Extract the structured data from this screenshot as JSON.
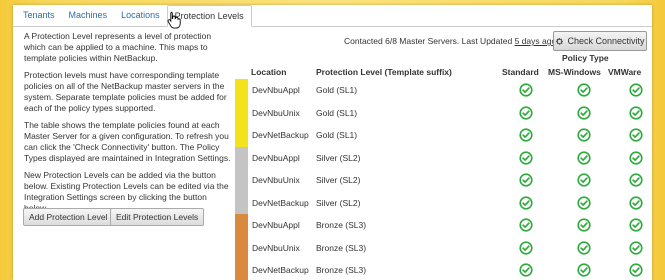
{
  "tabs": [
    {
      "label": "Tenants"
    },
    {
      "label": "Machines"
    },
    {
      "label": "Locations"
    },
    {
      "label": "Protection Levels",
      "active": true
    }
  ],
  "description": [
    "A Protection Level represents a level of protection which can be applied to a machine. This maps to template policies within NetBackup.",
    "Protection levels must have corresponding template policies on all of the NetBackup master servers in the system. Separate template policies must be added for each of the policy types supported.",
    "The table shows the template policies found at each Master Server for a given configuration. To refresh you can click the 'Check Connectivity' button. The Policy Types displayed are maintained in Integration Settings.",
    "New Protection Levels can be added via the button below. Existing Protection Levels can be edited via the Integration Settings screen by clicking the button below."
  ],
  "buttons": {
    "add": "Add Protection Level",
    "edit": "Edit Protection Levels",
    "check": "Check Connectivity"
  },
  "status": {
    "prefix": "Contacted 6/8 Master Servers. Last Updated",
    "link": "5 days ago"
  },
  "table": {
    "policy_type_header": "Policy Type",
    "col_location": "Location",
    "col_level": "Protection Level (Template suffix)",
    "col_standard": "Standard",
    "col_mswindows": "MS-Windows",
    "col_vmware": "VMWare",
    "rows": [
      {
        "location": "DevNbuAppl",
        "level": "Gold (SL1)",
        "tier": "gold"
      },
      {
        "location": "DevNbuUnix",
        "level": "Gold (SL1)",
        "tier": "gold"
      },
      {
        "location": "DevNetBackup",
        "level": "Gold (SL1)",
        "tier": "gold"
      },
      {
        "location": "DevNbuAppl",
        "level": "Silver (SL2)",
        "tier": "silver"
      },
      {
        "location": "DevNbuUnix",
        "level": "Silver (SL2)",
        "tier": "silver"
      },
      {
        "location": "DevNetBackup",
        "level": "Silver (SL2)",
        "tier": "silver"
      },
      {
        "location": "DevNbuAppl",
        "level": "Bronze (SL3)",
        "tier": "bronze"
      },
      {
        "location": "DevNbuUnix",
        "level": "Bronze (SL3)",
        "tier": "bronze"
      },
      {
        "location": "DevNetBackup",
        "level": "Bronze (SL3)",
        "tier": "bronze"
      }
    ]
  },
  "colors": {
    "gold": "#f2e31c",
    "silver": "#c4c4c4",
    "bronze": "#d98a3e",
    "check": "#2eab3c",
    "link": "#2a6eb0"
  },
  "icons": {
    "cell": "check-circle-icon",
    "settings": "gear-icon",
    "cursor": "hand-pointer-icon"
  }
}
